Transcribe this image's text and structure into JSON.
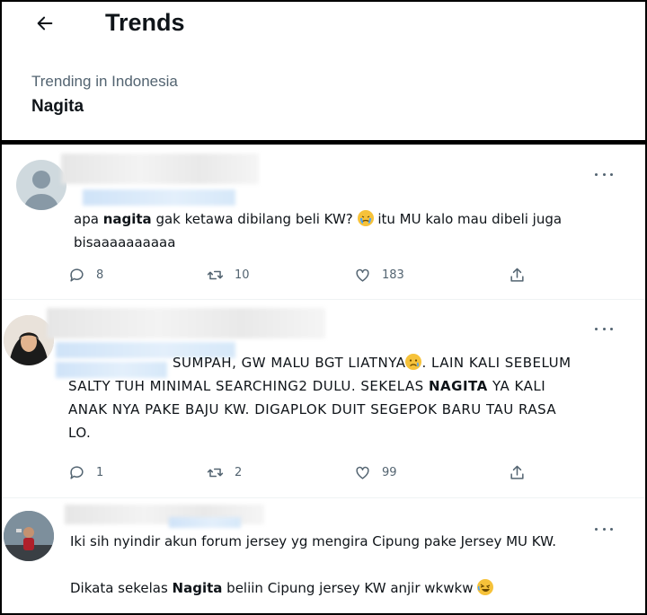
{
  "header": {
    "title": "Trends",
    "trend_context": "Trending in Indonesia",
    "trend_name": "Nagita"
  },
  "tweets": [
    {
      "text_before": "apa ",
      "highlight": "nagita",
      "text_after_1": " gak ketawa dibilang beli KW? ",
      "emoji_1": "crying-face-emoji",
      "text_after_2": " itu MU kalo mau dibeli juga",
      "text_line2": "bisaaaaaaaaaa",
      "replies": "8",
      "retweets": "10",
      "likes": "183"
    },
    {
      "line1": "SUMPAH, GW MALU BGT LIATNYA",
      "emoji_1": "sad-face-emoji",
      "line1_end": ". LAIN KALI SEBELUM",
      "line2_a": "SALTY TUH MINIMAL SEARCHING2 DULU. SEKELAS ",
      "highlight": "NAGITA",
      "line2_b": " YA KALI",
      "line3": "ANAK NYA PAKE BAJU KW. DIGAPLOK DUIT SEGEPOK BARU TAU RASA",
      "line4": "LO.",
      "replies": "1",
      "retweets": "2",
      "likes": "99"
    },
    {
      "line1": "Iki sih nyindir akun forum jersey yg mengira Cipung pake Jersey MU KW.",
      "line2_a": "Dikata sekelas ",
      "highlight": "Nagita",
      "line2_b": " beliin Cipung jersey KW anjir wkwkw ",
      "emoji_1": "rolling-laughing-emoji"
    }
  ],
  "colors": {
    "secondary_text": "#536471",
    "border": "#eff3f4",
    "emoji_yellow": "#f6c23a"
  }
}
